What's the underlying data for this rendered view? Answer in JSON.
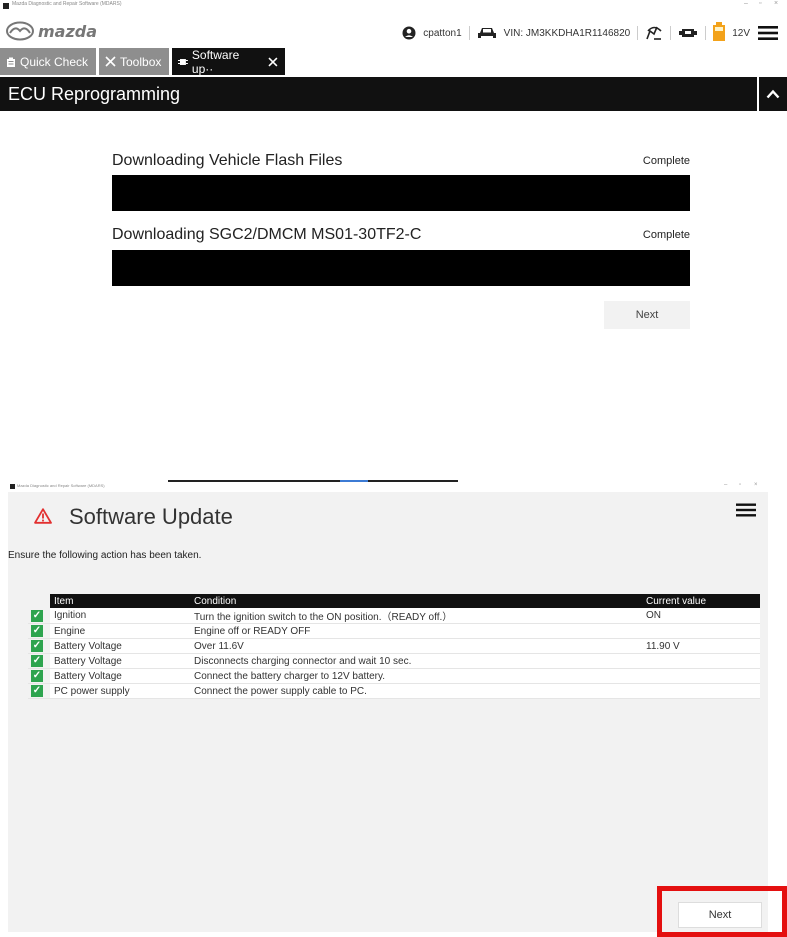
{
  "top_window": {
    "titlebar": "Mazda Diagnostic and Repair Software (MDARS)",
    "logo_text": "mazda",
    "header": {
      "user": "cpatton1",
      "vin": "VIN: JM3KKDHA1R1146820",
      "voltage": "12V"
    },
    "tabs": [
      {
        "label": "Quick Check"
      },
      {
        "label": "Toolbox"
      },
      {
        "label": "Software up··"
      }
    ],
    "section_title": "ECU Reprogramming",
    "downloads": [
      {
        "label": "Downloading Vehicle Flash Files",
        "status": "Complete",
        "progress": 1.0
      },
      {
        "label": "Downloading SGC2/DMCM MS01-30TF2-C",
        "status": "Complete",
        "progress": 1.0
      }
    ],
    "next_label": "Next"
  },
  "bottom_window": {
    "titlebar": "Mazda Diagnostic and Repair Software (MDARS)",
    "title": "Software Update",
    "instruction": "Ensure the following action has been taken.",
    "table": {
      "headers": [
        "Item",
        "Condition",
        "Current value"
      ],
      "rows": [
        {
          "item": "Ignition",
          "condition": "Turn the ignition switch to the ON position.（READY off.）",
          "value": "ON",
          "checked": true
        },
        {
          "item": "Engine",
          "condition": "Engine off or READY OFF",
          "value": "",
          "checked": true
        },
        {
          "item": "Battery Voltage",
          "condition": "Over 11.6V",
          "value": "11.90 V",
          "checked": true
        },
        {
          "item": "Battery Voltage",
          "condition": "Disconnects charging connector and wait 10 sec.",
          "value": "",
          "checked": true
        },
        {
          "item": "Battery Voltage",
          "condition": "Connect the battery charger to 12V battery.",
          "value": "",
          "checked": true
        },
        {
          "item": "PC power supply",
          "condition": "Connect the power supply cable to PC.",
          "value": "",
          "checked": true
        }
      ]
    },
    "next_label": "Next"
  },
  "colors": {
    "accent_dark": "#111111",
    "check_green": "#2ea44f",
    "battery_orange": "#f3a21a",
    "highlight_red": "#e41010"
  }
}
